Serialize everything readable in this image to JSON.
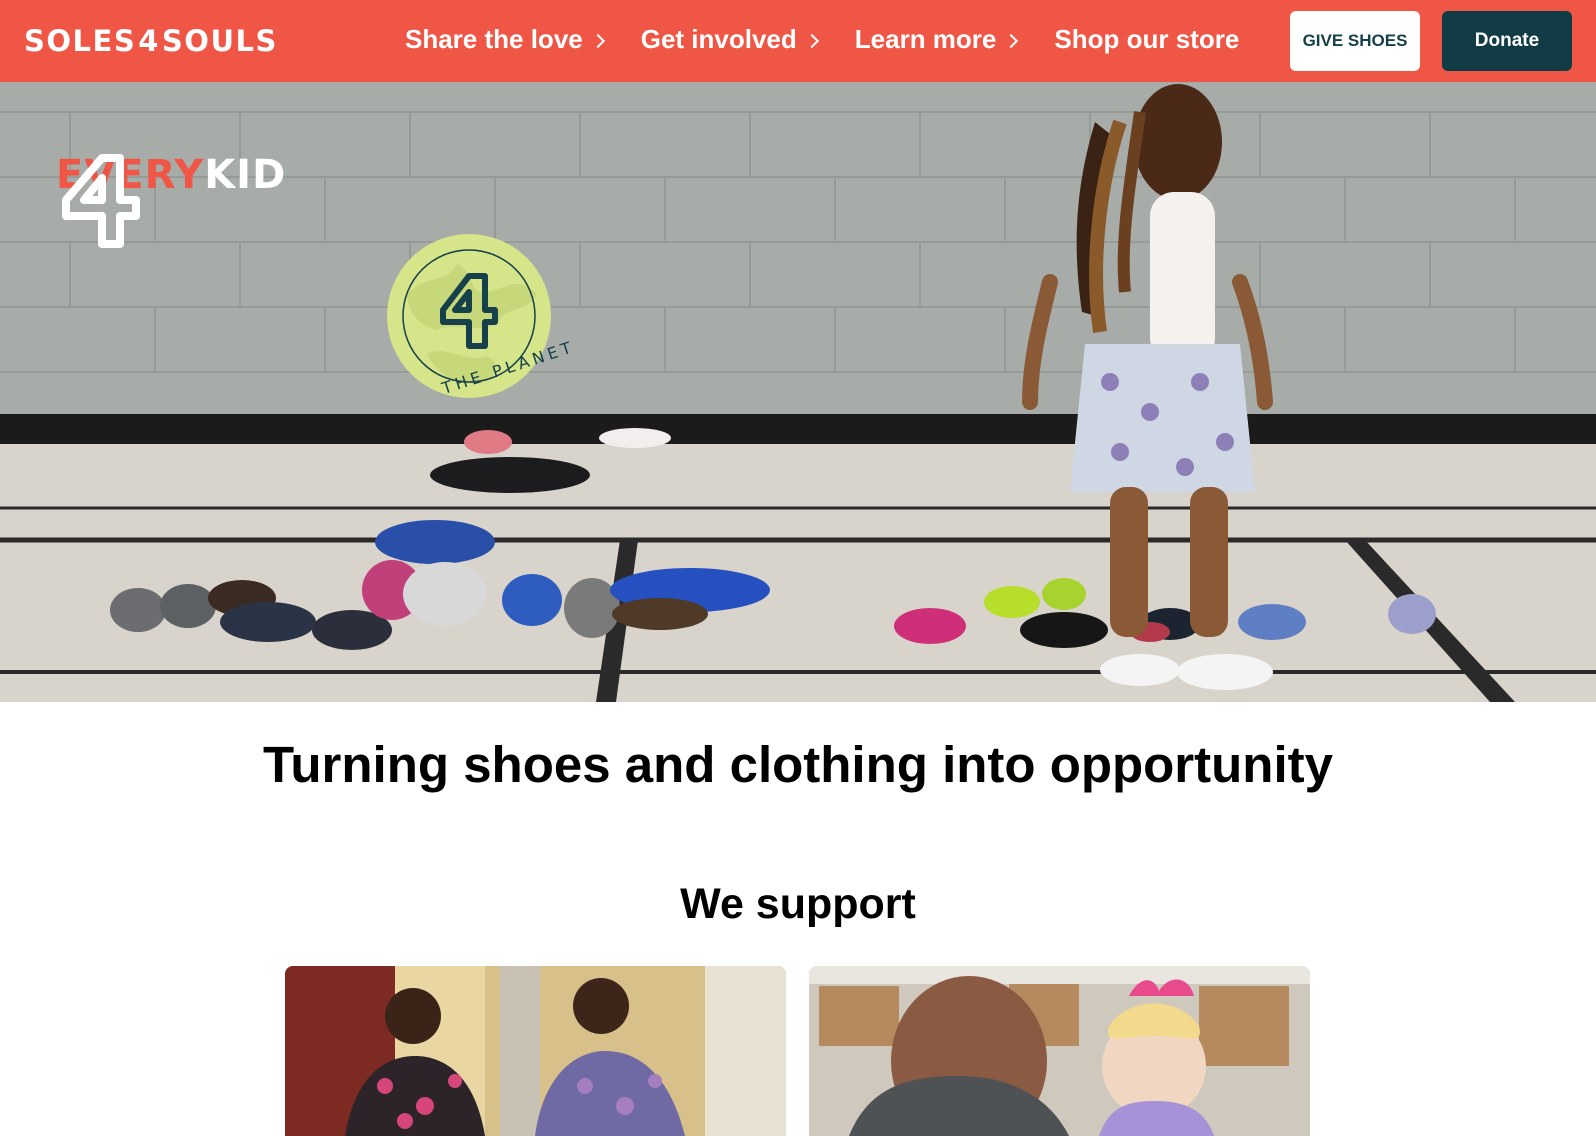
{
  "header": {
    "logo_left": "SOLES",
    "logo_four": "4",
    "logo_right": "SOULS",
    "nav": [
      {
        "label": "Share the love",
        "has_chevron": true
      },
      {
        "label": "Get involved",
        "has_chevron": true
      },
      {
        "label": "Learn more",
        "has_chevron": true
      },
      {
        "label": "Shop our store",
        "has_chevron": false
      }
    ],
    "give_shoes_label": "GIVE SHOES",
    "donate_label": "Donate"
  },
  "hero": {
    "badge_four": "4",
    "badge_every": "EVERY",
    "badge_kid": "KID",
    "planet_four": "4",
    "planet_label": "THE PLANET"
  },
  "main": {
    "headline": "Turning shoes and clothing into opportunity",
    "support_heading": "We support"
  },
  "colors": {
    "brand_coral": "#ef5645",
    "brand_dark_teal": "#123c45",
    "planet_green": "#d6e58a"
  }
}
